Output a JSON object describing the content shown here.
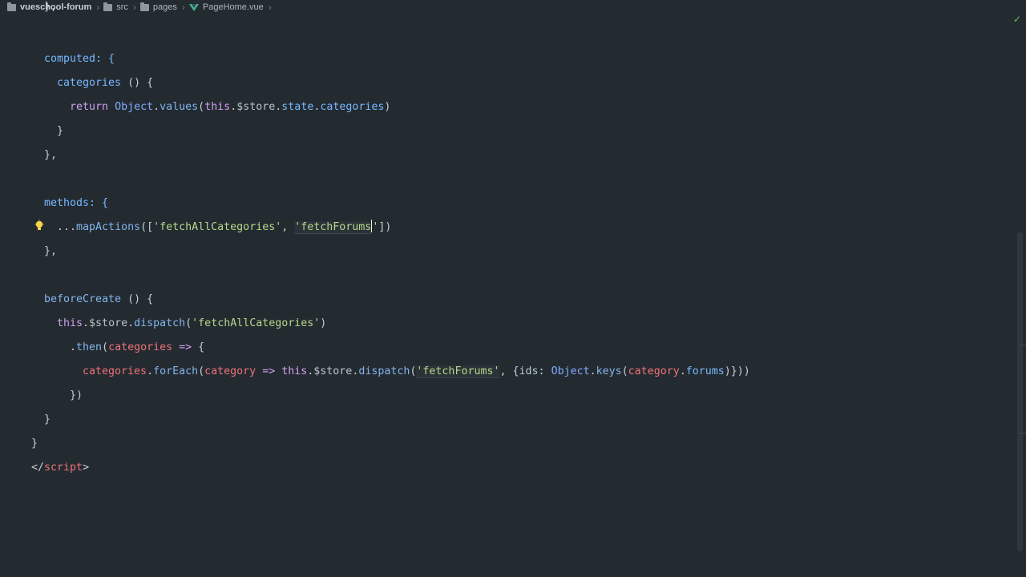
{
  "breadcrumb": {
    "project": "vueschool-forum",
    "folders": [
      "src",
      "pages"
    ],
    "file": "PageHome.vue"
  },
  "code_lines": {
    "l1": "computed: {",
    "l2_name": "categories",
    "l2_rest": " () {",
    "l3_return": "return",
    "l3_object": "Object",
    "l3_values": "values",
    "l3_this": "this",
    "l3_store": "$store",
    "l3_state": "state",
    "l3_categories": "categories",
    "l4": "}",
    "l5": "},",
    "l6": "methods: {",
    "l7_spread": "...",
    "l7_fn": "mapActions",
    "l7_s1": "'fetchAllCategories'",
    "l7_s2a": "'fetchForums",
    "l7_s2b": "'",
    "l8": "},",
    "l9_fn": "beforeCreate",
    "l10_this": "this",
    "l10_store": "$store",
    "l10_dispatch": "dispatch",
    "l10_str": "'fetchAllCategories'",
    "l11_then": "then",
    "l11_param": "categories",
    "l11_arrow": "=>",
    "l12_obj": "categories",
    "l12_forEach": "forEach",
    "l12_param": "category",
    "l12_arrow": "=>",
    "l12_this": "this",
    "l12_store": "$store",
    "l12_dispatch": "dispatch",
    "l12_str": "'fetchForums'",
    "l12_ids": "ids",
    "l12_object": "Object",
    "l12_keys": "keys",
    "l12_cat": "category",
    "l12_forums": "forums",
    "l13": "})",
    "l14": "}",
    "l15": "}",
    "l16_open": "</",
    "l16_tag": "script",
    "l16_close": ">"
  },
  "colors": {
    "background": "#232b31",
    "keyword": "#d3a0ef",
    "string": "#b6d78a",
    "function": "#84b3ec",
    "parameter": "#f07178",
    "success": "#6ebd5b",
    "bulb": "#f5d547"
  },
  "icons": {
    "status": "check-icon",
    "hint": "lightbulb-icon",
    "folder": "folder-icon",
    "vue_file": "vue-file-icon"
  }
}
